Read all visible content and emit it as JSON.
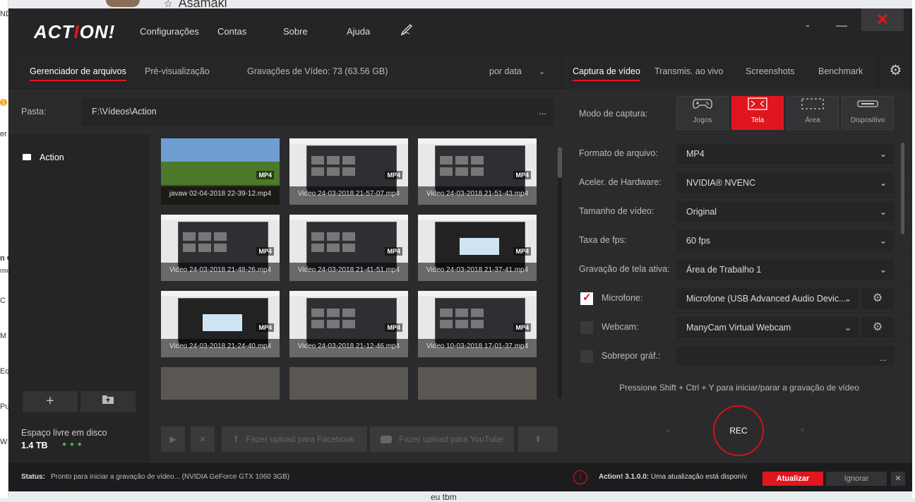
{
  "background": {
    "top_name": "Asamaki",
    "bottom_text": "eu tbm",
    "left_fragments": [
      "ND",
      "1",
      "er",
      "n C",
      "oso",
      "C",
      "M",
      "Eq",
      "Pu",
      "W"
    ]
  },
  "app": {
    "logo_main": "ACT",
    "logo_red": "I",
    "logo_end": "ON!",
    "menu": [
      "Configurações",
      "Contas",
      "Sobre",
      "Ajuda"
    ],
    "pen_icon": "pen-icon",
    "window": {
      "minimize": "-",
      "restore": "—",
      "close": "✕"
    }
  },
  "left": {
    "tabs": {
      "files": "Gerenciador de arquivos",
      "preview": "Pré-visualização",
      "recordings": "Gravações de Vídeo: 73 (63.56 GB)",
      "sort": "por data"
    },
    "path_label": "Pasta:",
    "path_value": "F:\\Vídeos\\Action",
    "path_more": "...",
    "folder": "Action",
    "add_label": "+",
    "disk_label": "Espaço livre em disco",
    "disk_value": "1.4 TB",
    "dots": "● ● ●",
    "thumbs": [
      {
        "name": "javaw 02-04-2018 22-39-12.mp4",
        "fmt": "MP4",
        "kind": "game"
      },
      {
        "name": "Video 24-03-2018 21-57-07.mp4",
        "fmt": "MP4",
        "kind": "screen"
      },
      {
        "name": "Video 24-03-2018 21-51-43.mp4",
        "fmt": "MP4",
        "kind": "screen"
      },
      {
        "name": "Video 24-03-2018 21-48-26.mp4",
        "fmt": "MP4",
        "kind": "screen"
      },
      {
        "name": "Video 24-03-2018 21-41-51.mp4",
        "fmt": "MP4",
        "kind": "screen"
      },
      {
        "name": "Video 24-03-2018 21-37-41.mp4",
        "fmt": "MP4",
        "kind": "call"
      },
      {
        "name": "Video 24-03-2018 21-24-40.mp4",
        "fmt": "MP4",
        "kind": "call"
      },
      {
        "name": "Video 24-03-2018 21-12-46.mp4",
        "fmt": "MP4",
        "kind": "screen"
      },
      {
        "name": "Video 10-03-2018 17-01-37.mp4",
        "fmt": "MP4",
        "kind": "screen"
      }
    ],
    "actions": {
      "facebook": "Fazer upload para Facebook",
      "youtube": "Fazer upload para YouTube"
    }
  },
  "right": {
    "tabs": [
      "Captura de vídeo",
      "Transmis. ao vivo",
      "Screenshots",
      "Benchmark"
    ],
    "mode_label": "Modo de captura:",
    "modes": [
      {
        "label": "Jogos",
        "icon": "gamepad-icon"
      },
      {
        "label": "Tela",
        "icon": "fullscreen-icon"
      },
      {
        "label": "Área",
        "icon": "area-icon"
      },
      {
        "label": "Dispositivo",
        "icon": "device-icon"
      }
    ],
    "settings": [
      {
        "label": "Formato de arquivo:",
        "value": "MP4"
      },
      {
        "label": "Aceler. de Hardware:",
        "value": "NVIDIA® NVENC"
      },
      {
        "label": "Tamanho de vídeo:",
        "value": "Original"
      },
      {
        "label": "Taxa de fps:",
        "value": "60 fps"
      },
      {
        "label": "Gravação de tela ativa:",
        "value": "Área de Trabalho 1"
      },
      {
        "label": "Microfone:",
        "value": "Microfone (USB Advanced Audio Devic...",
        "checked": true
      },
      {
        "label": "Webcam:",
        "value": "ManyCam Virtual Webcam",
        "checked": false
      },
      {
        "label": "Sobrepor gráf.:",
        "value": "...",
        "checked": false
      }
    ],
    "hint": "Pressione Shift + Ctrl + Y para iniciar/parar a gravação de vídeo",
    "rec": "REC"
  },
  "status": {
    "label": "Status:",
    "text": "Pronto para iniciar a gravação de vídeo... (NVIDIA GeForce GTX 1060 3GB)",
    "update_version": "Action! 3.1.0.0:",
    "update_text": "Uma atualização está disponív",
    "update_btn": "Atualizar",
    "ignore_btn": "Ignorar",
    "close": "✕"
  },
  "colors": {
    "accent": "#e0161e",
    "panel": "#2b2b2d",
    "dark": "#252527"
  }
}
